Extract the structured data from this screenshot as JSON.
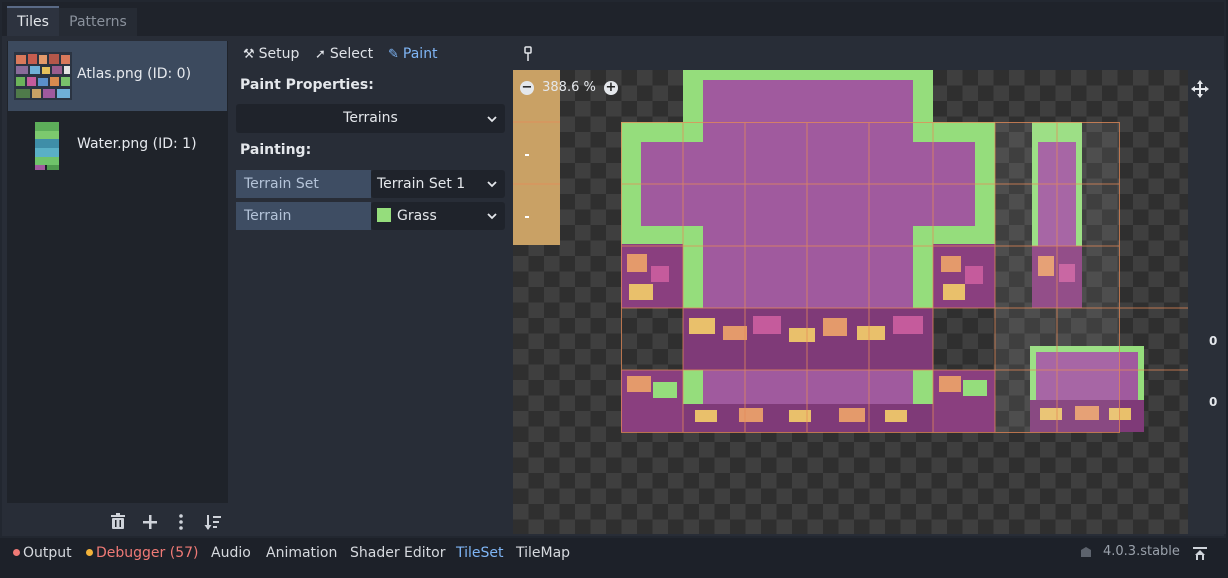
{
  "tabs": [
    {
      "label": "Tiles"
    },
    {
      "label": "Patterns"
    }
  ],
  "sources": [
    {
      "label": "Atlas.png (ID: 0)",
      "selected": true,
      "icon": "atlas-thumbnail"
    },
    {
      "label": "Water.png (ID: 1)",
      "selected": false,
      "icon": "water-thumbnail"
    }
  ],
  "source_actions": [
    "trash-icon",
    "plus-icon",
    "kebab-menu-icon",
    "sort-icon"
  ],
  "toolbar": {
    "setup": "Setup",
    "select": "Select",
    "paint": "Paint",
    "active": "paint"
  },
  "paint_panel": {
    "properties_title": "Paint Properties:",
    "mode": "Terrains",
    "painting_title": "Painting:",
    "terrain_set_label": "Terrain Set",
    "terrain_set_value": "Terrain Set 1",
    "terrain_label": "Terrain",
    "terrain_value": "Grass",
    "terrain_color": "#95dd7c"
  },
  "viewport": {
    "zoom": "388.6 %",
    "edge_labels": [
      "0",
      "0"
    ]
  },
  "bottom_tabs": [
    {
      "label": "Output"
    },
    {
      "label": "Debugger (57)"
    },
    {
      "label": "Audio"
    },
    {
      "label": "Animation"
    },
    {
      "label": "Shader Editor"
    },
    {
      "label": "TileSet"
    },
    {
      "label": "TileMap"
    }
  ],
  "version": "4.0.3.stable",
  "colors": {
    "accent": "#7fb5f5",
    "error": "#f07a76",
    "warning": "#f3b33a",
    "grass": "#95dd7c",
    "tile_purple": "#a05a9e",
    "sand": "#c9a165"
  }
}
